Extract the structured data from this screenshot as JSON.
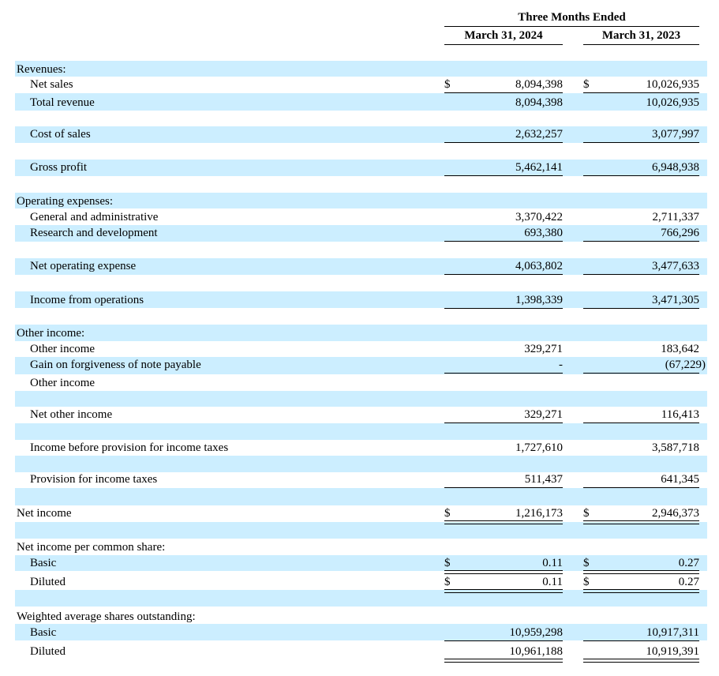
{
  "header": {
    "group": "Three Months Ended",
    "col1": "March 31, 2024",
    "col2": "March 31, 2023"
  },
  "rows": {
    "revenues_h": "Revenues:",
    "net_sales": {
      "label": "Net sales",
      "cur": "$",
      "v1": "8,094,398",
      "v2": "10,026,935"
    },
    "total_revenue": {
      "label": "Total revenue",
      "v1": "8,094,398",
      "v2": "10,026,935"
    },
    "cost_of_sales": {
      "label": "Cost of sales",
      "v1": "2,632,257",
      "v2": "3,077,997"
    },
    "gross_profit": {
      "label": "Gross profit",
      "v1": "5,462,141",
      "v2": "6,948,938"
    },
    "opex_h": "Operating expenses:",
    "ga": {
      "label": "General and administrative",
      "v1": "3,370,422",
      "v2": "2,711,337"
    },
    "rd": {
      "label": "Research and development",
      "v1": "693,380",
      "v2": "766,296"
    },
    "net_opex": {
      "label": "Net operating expense",
      "v1": "4,063,802",
      "v2": "3,477,633"
    },
    "inc_ops": {
      "label": "Income from operations",
      "v1": "1,398,339",
      "v2": "3,471,305"
    },
    "other_h": "Other income:",
    "other_income": {
      "label": "Other income",
      "v1": "329,271",
      "v2": "183,642"
    },
    "gain_forgive": {
      "label": "Gain on forgiveness of note payable",
      "v1": "-",
      "v2": "(67,229)"
    },
    "other_income2": {
      "label": "Other income"
    },
    "net_other": {
      "label": "Net other income",
      "v1": "329,271",
      "v2": "116,413"
    },
    "pretax": {
      "label": "Income before provision for income taxes",
      "v1": "1,727,610",
      "v2": "3,587,718"
    },
    "tax": {
      "label": "Provision for income taxes",
      "v1": "511,437",
      "v2": "641,345"
    },
    "net_income": {
      "label": "Net income",
      "cur": "$",
      "v1": "1,216,173",
      "v2": "2,946,373"
    },
    "eps_h": "Net income per common share:",
    "eps_basic": {
      "label": "Basic",
      "cur": "$",
      "v1": "0.11",
      "v2": "0.27"
    },
    "eps_diluted": {
      "label": "Diluted",
      "cur": "$",
      "v1": "0.11",
      "v2": "0.27"
    },
    "shares_h": "Weighted average shares outstanding:",
    "sh_basic": {
      "label": "Basic",
      "v1": "10,959,298",
      "v2": "10,917,311"
    },
    "sh_diluted": {
      "label": "Diluted",
      "v1": "10,961,188",
      "v2": "10,919,391"
    }
  }
}
